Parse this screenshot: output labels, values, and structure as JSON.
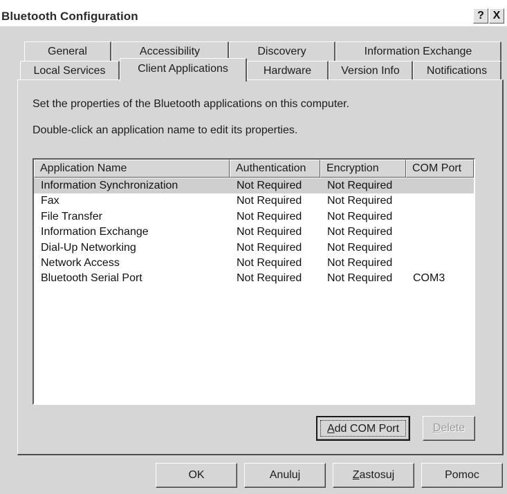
{
  "window": {
    "title": "Bluetooth Configuration",
    "help_glyph": "?",
    "close_glyph": "X"
  },
  "tabs_row1": [
    {
      "label": "General"
    },
    {
      "label": "Accessibility"
    },
    {
      "label": "Discovery"
    },
    {
      "label": "Information Exchange"
    }
  ],
  "tabs_row2": [
    {
      "label": "Local Services"
    },
    {
      "label": "Client Applications",
      "active": true
    },
    {
      "label": "Hardware"
    },
    {
      "label": "Version Info"
    },
    {
      "label": "Notifications"
    }
  ],
  "panel": {
    "description1": "Set the properties of the Bluetooth applications on this computer.",
    "description2": "Double-click an application name to edit its properties."
  },
  "table": {
    "columns": [
      "Application Name",
      "Authentication",
      "Encryption",
      "COM Port"
    ],
    "rows": [
      {
        "name": "Information Synchronization",
        "auth": "Not Required",
        "enc": "Not Required",
        "com": "",
        "selected": true
      },
      {
        "name": "Fax",
        "auth": "Not Required",
        "enc": "Not Required",
        "com": ""
      },
      {
        "name": "File Transfer",
        "auth": "Not Required",
        "enc": "Not Required",
        "com": ""
      },
      {
        "name": "Information Exchange",
        "auth": "Not Required",
        "enc": "Not Required",
        "com": ""
      },
      {
        "name": "Dial-Up Networking",
        "auth": "Not Required",
        "enc": "Not Required",
        "com": ""
      },
      {
        "name": "Network Access",
        "auth": "Not Required",
        "enc": "Not Required",
        "com": ""
      },
      {
        "name": "Bluetooth Serial Port",
        "auth": "Not Required",
        "enc": "Not Required",
        "com": "COM3"
      }
    ]
  },
  "panel_buttons": {
    "add_com_port": {
      "prefix": "",
      "mnemonic": "A",
      "rest": "dd COM Port"
    },
    "delete": {
      "prefix": "",
      "mnemonic": "D",
      "rest": "elete"
    }
  },
  "dialog_buttons": {
    "ok": "OK",
    "cancel": "Anuluj",
    "apply": {
      "mnemonic": "Z",
      "rest": "astosuj"
    },
    "help": "Pomoc"
  }
}
